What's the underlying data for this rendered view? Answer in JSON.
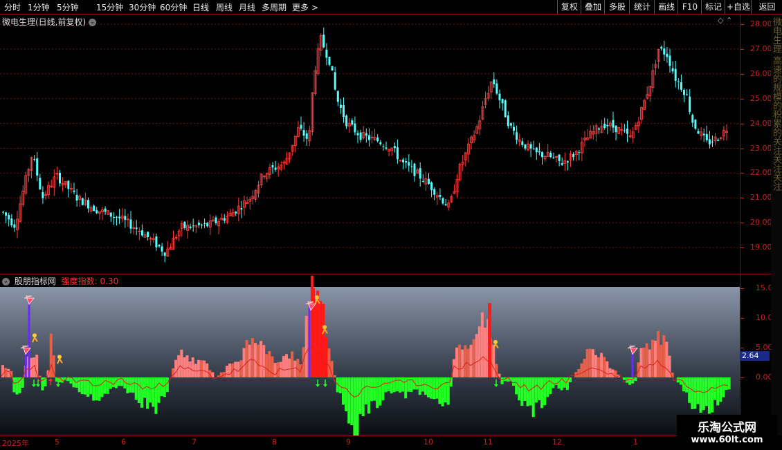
{
  "toolbar": {
    "periods": [
      "分时",
      "1分钟",
      "5分钟",
      "15分钟",
      "30分钟",
      "60分钟",
      "日线",
      "周线",
      "月线",
      "多周期",
      "更多 >"
    ],
    "active_period": "日线",
    "right_buttons": [
      "复权",
      "叠加",
      "多股",
      "统计",
      "画线",
      "F10",
      "标记",
      "+自选",
      "返回"
    ]
  },
  "main_chart": {
    "title": "微电生理(日线,前复权)",
    "price_labels": [
      "28.00",
      "27.00",
      "26.00",
      "25.00",
      "24.00",
      "23.00",
      "22.00",
      "21.00",
      "20.00",
      "19.00"
    ],
    "price_values": [
      28,
      27,
      26,
      25,
      24,
      23,
      22,
      21,
      20,
      19
    ],
    "candle_up_color": "#ff3b3b",
    "candle_down_color": "#54ffff"
  },
  "indicator": {
    "name": "股朋指标网",
    "param_label": "强度指数:",
    "param_value": "0.30",
    "axis_labels": [
      "15.00",
      "10.00",
      "5.00",
      "0.00"
    ],
    "axis_values": [
      15,
      10,
      5,
      0
    ],
    "current_value": "2.64",
    "pos_color_light": "#ff7f7f",
    "pos_color_dark": "#e8604a",
    "neg_color": "#22ff22",
    "strong_color": "#ff1a1a"
  },
  "date_axis": {
    "labels": [
      "2025年",
      "5",
      "6",
      "7",
      "8",
      "9",
      "10",
      "11",
      "12",
      "1"
    ]
  },
  "info_strip_text": "微电生理 高速的规模的积累的关注关注关注",
  "watermark": {
    "title": "乐淘公式网",
    "url": "www.60lt.com"
  }
}
